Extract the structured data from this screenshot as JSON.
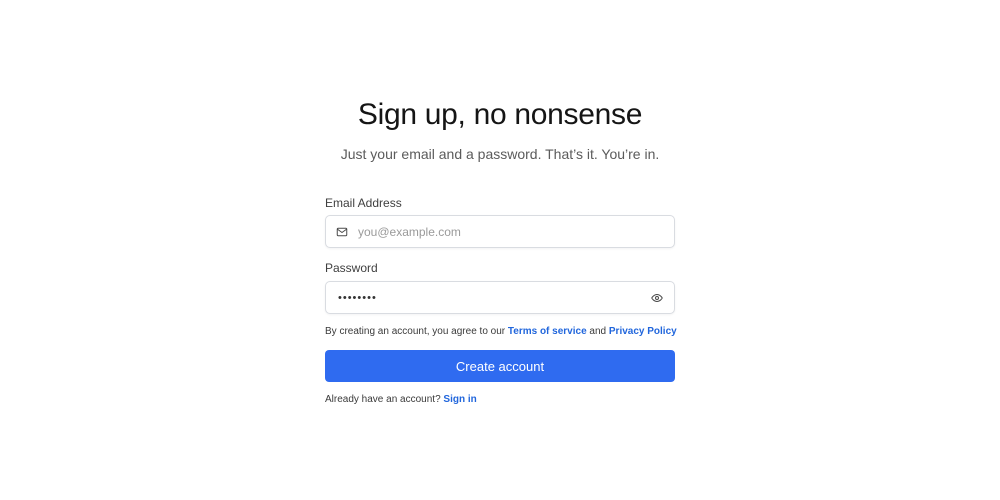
{
  "header": {
    "title": "Sign up, no nonsense",
    "subtitle": "Just your email and a password. That’s it. You’re in."
  },
  "form": {
    "email": {
      "label": "Email Address",
      "placeholder": "you@example.com",
      "value": "",
      "icon": "mail-icon"
    },
    "password": {
      "label": "Password",
      "value": "••••••••",
      "icon": "eye-icon"
    },
    "terms": {
      "prefix": "By creating an account, you agree to our ",
      "terms_link": "Terms of service",
      "conjunction": " and ",
      "privacy_link": "Privacy Policy"
    },
    "submit_label": "Create account",
    "signin": {
      "prompt": "Already have an account? ",
      "link": "Sign in"
    }
  },
  "colors": {
    "accent": "#2f6bf0",
    "link": "#2166dc",
    "border": "#d9dce1"
  }
}
